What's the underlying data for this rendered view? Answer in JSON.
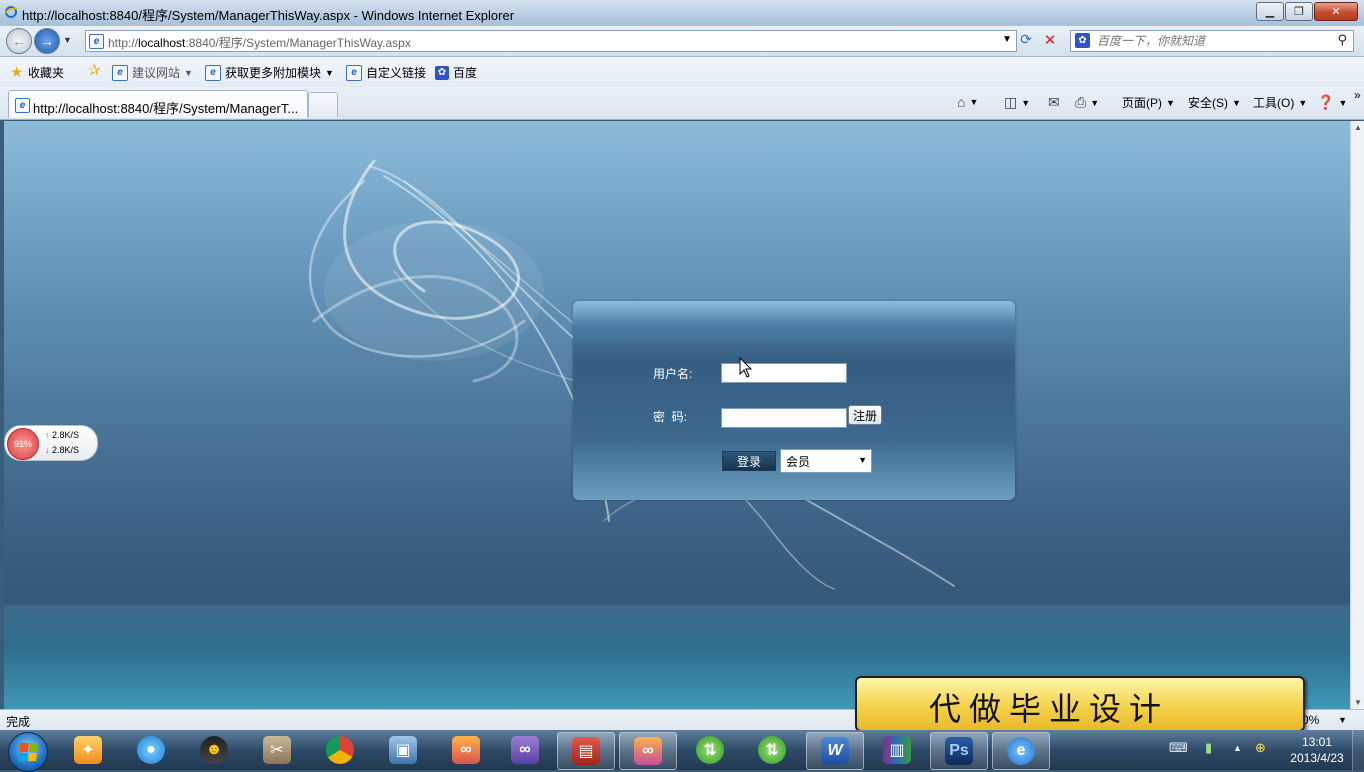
{
  "window": {
    "title": "http://localhost:8840/程序/System/ManagerThisWay.aspx - Windows Internet Explorer"
  },
  "address_bar": {
    "url_prefix": "http://",
    "url_host": "localhost",
    "url_rest": ":8840/程序/System/ManagerThisWay.aspx"
  },
  "search": {
    "placeholder": "百度一下，你就知道"
  },
  "favorites_bar": {
    "favorites_label": "收藏夹",
    "items": [
      {
        "label": "建议网站",
        "icon": "ie-page-icon",
        "dropdown": true
      },
      {
        "label": "获取更多附加模块",
        "icon": "ie-page-icon",
        "dropdown": true
      },
      {
        "label": "自定义链接",
        "icon": "ie-page-icon",
        "dropdown": false
      },
      {
        "label": "百度",
        "icon": "baidu-paw-icon",
        "dropdown": false
      }
    ]
  },
  "tab": {
    "label": "http://localhost:8840/程序/System/ManagerT..."
  },
  "command_bar": {
    "page": "页面(P)",
    "safety": "安全(S)",
    "tools": "工具(O)"
  },
  "login": {
    "username_label": "用户名:",
    "password_label": "密  码:",
    "register_button": "注册",
    "login_button": "登录",
    "role_selected": "会员",
    "username_value": "",
    "password_value": ""
  },
  "net_widget": {
    "percent": "91%",
    "upload": "2.8K/S",
    "download": "2.8K/S"
  },
  "status_bar": {
    "status": "完成",
    "zoom": "0%"
  },
  "promo": {
    "text": "代做毕业设计"
  },
  "taskbar": {
    "time": "13:01",
    "date": "2013/4/23"
  },
  "colors": {
    "login_panel": "#3b6487",
    "promo_bg": "#f4d24a",
    "taskbar": "#2e4a68"
  }
}
